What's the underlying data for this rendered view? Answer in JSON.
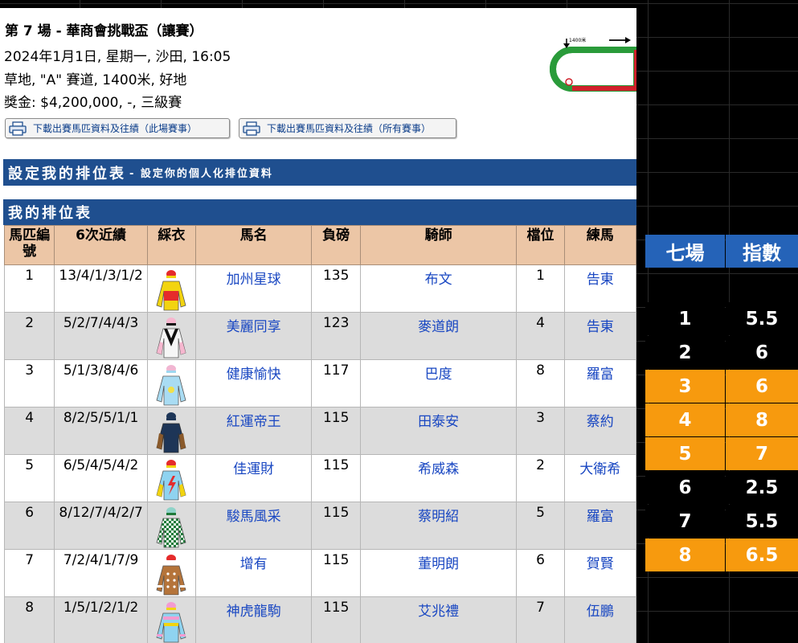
{
  "race": {
    "title": "第 7 場 - 華商會挑戰盃（讓賽）",
    "line1": "2024年1月1日, 星期一, 沙田, 16:05",
    "line2": "草地, \"A\" 賽道, 1400米, 好地",
    "line3": "獎金: $4,200,000, -, 三級賽"
  },
  "buttons": {
    "download_this": "下載出賽馬匹資料及往績（此場賽事）",
    "download_all": "下載出賽馬匹資料及往績（所有賽事）"
  },
  "track_map": {
    "distance_label": "1400米"
  },
  "settings_bar": {
    "title": "設定我的排位表",
    "subtitle": "- 設定你的個人化排位資料"
  },
  "my_table_bar": {
    "title": "我的排位表"
  },
  "table": {
    "headers": [
      "馬匹編號",
      "6次近績",
      "綵衣",
      "馬名",
      "負磅",
      "騎師",
      "檔位",
      "練馬"
    ],
    "rows": [
      {
        "no": "1",
        "form": "13/4/1/3/1/2",
        "horse": "加州星球",
        "weight": "135",
        "jockey": "布文",
        "draw": "1",
        "trainer": "告東"
      },
      {
        "no": "2",
        "form": "5/2/7/4/4/3",
        "horse": "美麗同享",
        "weight": "123",
        "jockey": "麥道朗",
        "draw": "4",
        "trainer": "告東"
      },
      {
        "no": "3",
        "form": "5/1/3/8/4/6",
        "horse": "健康愉快",
        "weight": "117",
        "jockey": "巴度",
        "draw": "8",
        "trainer": "羅富"
      },
      {
        "no": "4",
        "form": "8/2/5/5/1/1",
        "horse": "紅運帝王",
        "weight": "115",
        "jockey": "田泰安",
        "draw": "3",
        "trainer": "蔡約"
      },
      {
        "no": "5",
        "form": "6/5/4/5/4/2",
        "horse": "佳運財",
        "weight": "115",
        "jockey": "希威森",
        "draw": "2",
        "trainer": "大衛希"
      },
      {
        "no": "6",
        "form": "8/12/7/4/2/7",
        "horse": "駿馬風采",
        "weight": "115",
        "jockey": "蔡明紹",
        "draw": "5",
        "trainer": "羅富"
      },
      {
        "no": "7",
        "form": "7/2/4/1/7/9",
        "horse": "增有",
        "weight": "115",
        "jockey": "董明朗",
        "draw": "6",
        "trainer": "賀賢"
      },
      {
        "no": "8",
        "form": "1/5/1/2/1/2",
        "horse": "神虎龍駒",
        "weight": "115",
        "jockey": "艾兆禮",
        "draw": "7",
        "trainer": "伍鵬"
      }
    ]
  },
  "summary": {
    "header_race": "七場",
    "header_index": "指數",
    "rows": [
      {
        "no": "1",
        "index": "5.5"
      },
      {
        "no": "2",
        "index": "6"
      },
      {
        "no": "3",
        "index": "6"
      },
      {
        "no": "4",
        "index": "8"
      },
      {
        "no": "5",
        "index": "7"
      },
      {
        "no": "6",
        "index": "2.5"
      },
      {
        "no": "7",
        "index": "5.5"
      },
      {
        "no": "8",
        "index": "6.5"
      }
    ]
  },
  "colors": {
    "bar_blue": "#1f4f8f",
    "header_tan": "#ecc6a6",
    "highlight_orange": "#f79a0e",
    "summary_blue": "#2563b8",
    "link_blue": "#1947c2"
  }
}
